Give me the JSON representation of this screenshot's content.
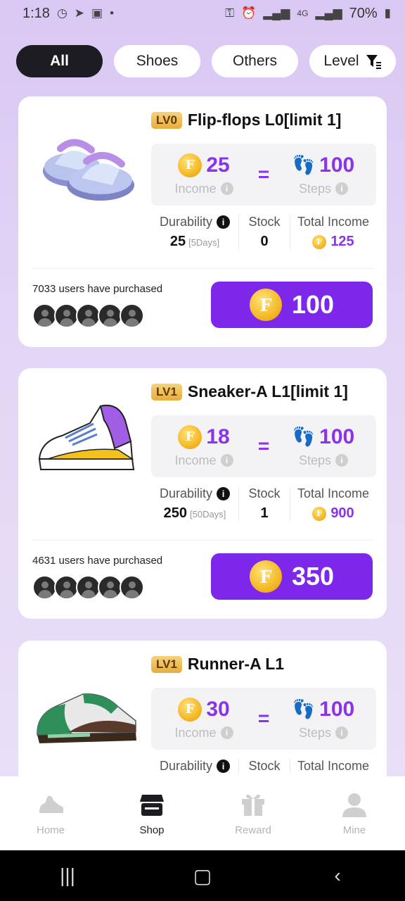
{
  "status": {
    "time": "1:18",
    "battery": "70%",
    "network": "4G"
  },
  "tabs": [
    {
      "label": "All",
      "active": true
    },
    {
      "label": "Shoes",
      "active": false
    },
    {
      "label": "Others",
      "active": false
    },
    {
      "label": "Level",
      "active": false
    }
  ],
  "cards": [
    {
      "level": "LV0",
      "title": "Flip-flops L0[limit 1]",
      "income": "25",
      "income_label": "Income",
      "steps": "100",
      "steps_label": "Steps",
      "durability_label": "Durability",
      "durability": "25",
      "durability_days": "[5Days]",
      "stock_label": "Stock",
      "stock": "0",
      "total_label": "Total Income",
      "total": "125",
      "purchased": "7033 users have purchased",
      "price": "100"
    },
    {
      "level": "LV1",
      "title": "Sneaker-A L1[limit 1]",
      "income": "18",
      "income_label": "Income",
      "steps": "100",
      "steps_label": "Steps",
      "durability_label": "Durability",
      "durability": "250",
      "durability_days": "[50Days]",
      "stock_label": "Stock",
      "stock": "1",
      "total_label": "Total Income",
      "total": "900",
      "purchased": "4631 users have purchased",
      "price": "350"
    },
    {
      "level": "LV1",
      "title": "Runner-A L1",
      "income": "30",
      "income_label": "Income",
      "steps": "100",
      "steps_label": "Steps",
      "durability_label": "Durability",
      "stock_label": "Stock",
      "total_label": "Total Income"
    }
  ],
  "coin_symbol": "F",
  "nav": [
    {
      "label": "Home",
      "icon": "shoe-icon"
    },
    {
      "label": "Shop",
      "icon": "shop-icon"
    },
    {
      "label": "Reward",
      "icon": "gift-icon"
    },
    {
      "label": "Mine",
      "icon": "user-icon"
    }
  ],
  "colors": {
    "accent": "#7d27eb",
    "badge": "#e6ad3d",
    "active_tab": "#1c1c22"
  }
}
